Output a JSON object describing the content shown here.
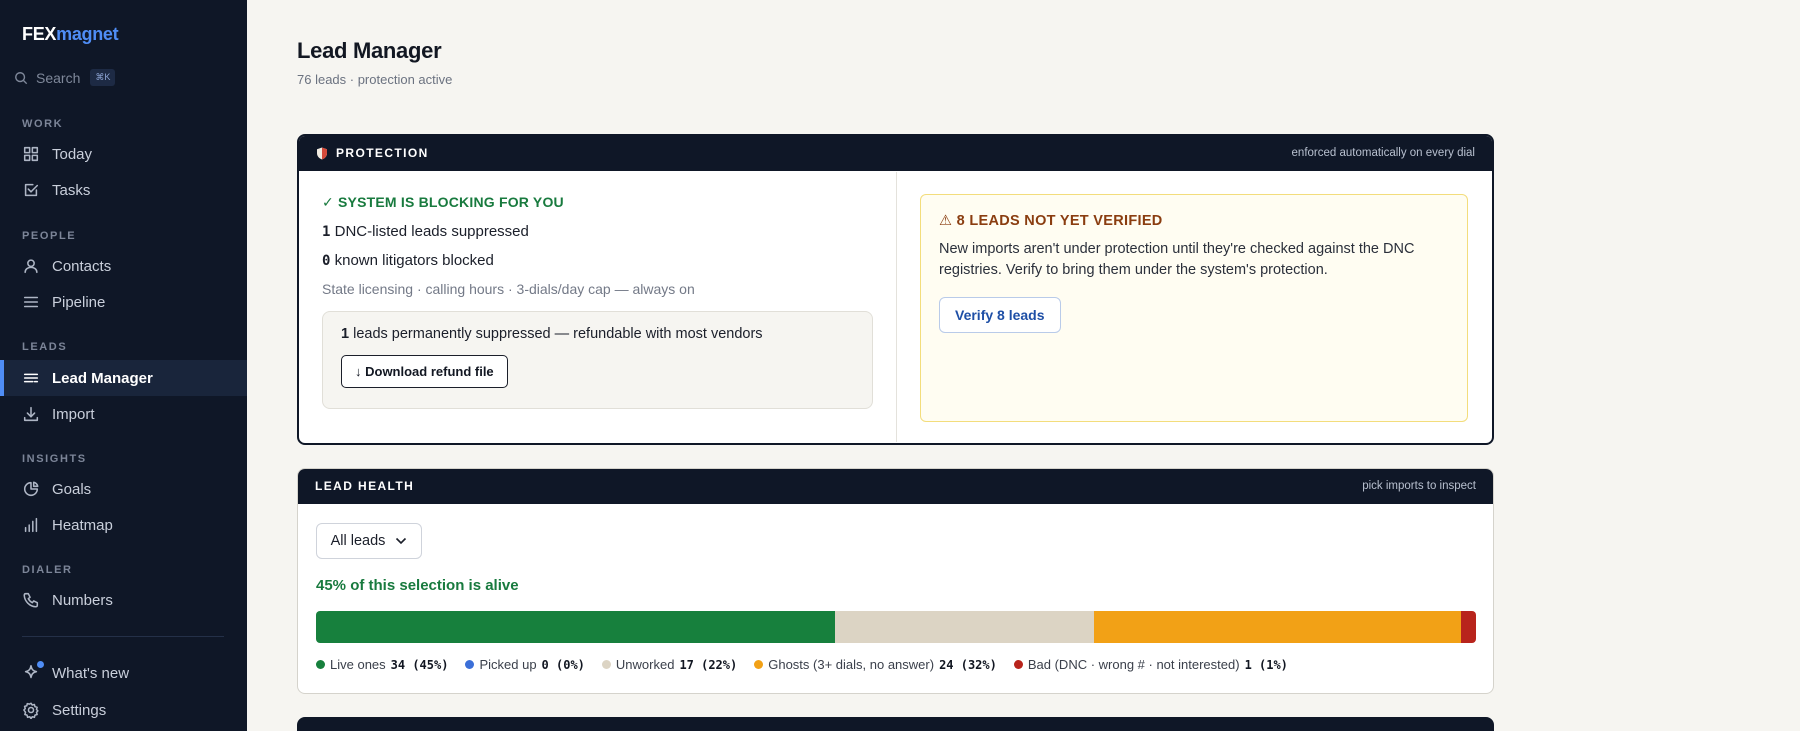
{
  "brand": {
    "part1": "FEX",
    "part2": "magnet"
  },
  "search": {
    "label": "Search",
    "shortcut": "⌘K"
  },
  "sidebar": {
    "sections": [
      {
        "title": "WORK",
        "items": [
          {
            "label": "Today",
            "icon": "grid-icon"
          },
          {
            "label": "Tasks",
            "icon": "checkbox-icon"
          }
        ]
      },
      {
        "title": "PEOPLE",
        "items": [
          {
            "label": "Contacts",
            "icon": "user-icon"
          },
          {
            "label": "Pipeline",
            "icon": "list-icon"
          }
        ]
      },
      {
        "title": "LEADS",
        "items": [
          {
            "label": "Lead Manager",
            "icon": "lines-icon",
            "active": true
          },
          {
            "label": "Import",
            "icon": "download-icon"
          }
        ]
      },
      {
        "title": "INSIGHTS",
        "items": [
          {
            "label": "Goals",
            "icon": "pie-icon"
          },
          {
            "label": "Heatmap",
            "icon": "bars-icon"
          }
        ]
      },
      {
        "title": "DIALER",
        "items": [
          {
            "label": "Numbers",
            "icon": "phone-icon"
          }
        ]
      }
    ],
    "footer": [
      {
        "label": "What's new",
        "icon": "sparkle-icon"
      },
      {
        "label": "Settings",
        "icon": "gear-icon"
      }
    ]
  },
  "header": {
    "title": "Lead Manager",
    "subtitle": "76 leads · protection active"
  },
  "protection": {
    "title": "PROTECTION",
    "note": "enforced automatically on every dial",
    "blocking_title": "✓ SYSTEM IS BLOCKING FOR YOU",
    "dnc_count": "1",
    "dnc_label": "DNC-listed leads suppressed",
    "litigator_count": "0",
    "litigator_label": "known litigators blocked",
    "rules": "State licensing · calling hours · 3-dials/day cap — always on",
    "suppressed_count": "1",
    "suppressed_label": "leads permanently suppressed — refundable with most vendors",
    "download_button": "↓ Download refund file",
    "warn_title": "⚠ 8 LEADS NOT YET VERIFIED",
    "warn_text": "New imports aren't under protection until they're checked against the DNC registries. Verify to bring them under the system's protection.",
    "verify_button": "Verify 8 leads"
  },
  "health": {
    "title": "LEAD HEALTH",
    "note": "pick imports to inspect",
    "select_value": "All leads",
    "alive_text": "45% of this selection is alive",
    "segments": [
      {
        "label": "Live ones",
        "value": "34 (45%)",
        "count": 34,
        "color": "#17803d"
      },
      {
        "label": "Picked up",
        "value": "0 (0%)",
        "count": 0,
        "color": "#3b6fd8"
      },
      {
        "label": "Unworked",
        "value": "17 (22%)",
        "count": 17,
        "color": "#dcd4c4"
      },
      {
        "label": "Ghosts (3+ dials, no answer)",
        "value": "24 (32%)",
        "count": 24,
        "color": "#f2a116"
      },
      {
        "label": "Bad (DNC · wrong # · not interested)",
        "value": "1 (1%)",
        "count": 1,
        "color": "#b8241c"
      }
    ]
  }
}
